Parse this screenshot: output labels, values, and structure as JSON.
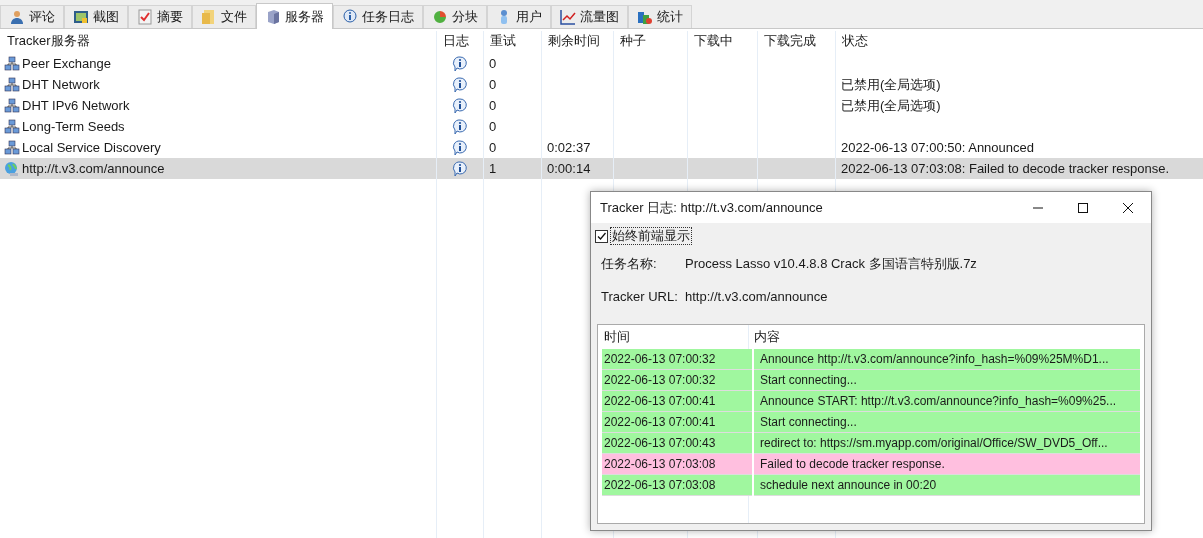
{
  "tabs": [
    {
      "label": "评论",
      "kind": "user",
      "selected": false
    },
    {
      "label": "截图",
      "kind": "image",
      "selected": false
    },
    {
      "label": "摘要",
      "kind": "check",
      "selected": false
    },
    {
      "label": "文件",
      "kind": "files",
      "selected": false
    },
    {
      "label": "服务器",
      "kind": "server",
      "selected": true
    },
    {
      "label": "任务日志",
      "kind": "info",
      "selected": false
    },
    {
      "label": "分块",
      "kind": "pie",
      "selected": false
    },
    {
      "label": "用户",
      "kind": "person",
      "selected": false
    },
    {
      "label": "流量图",
      "kind": "graph",
      "selected": false
    },
    {
      "label": "统计",
      "kind": "stats",
      "selected": false
    }
  ],
  "table": {
    "columns": [
      "Tracker服务器",
      "日志",
      "重试",
      "剩余时间",
      "种子",
      "下载中",
      "下载完成",
      "状态"
    ],
    "rows": [
      {
        "kind": "network",
        "name": "Peer Exchange",
        "retry": "0",
        "selected": false
      },
      {
        "kind": "network",
        "name": "DHT Network",
        "retry": "0",
        "status": "已禁用(全局选项)",
        "selected": false
      },
      {
        "kind": "network",
        "name": "DHT IPv6 Network",
        "retry": "0",
        "status": "已禁用(全局选项)",
        "selected": false
      },
      {
        "kind": "network",
        "name": "Long-Term Seeds",
        "retry": "0",
        "selected": false
      },
      {
        "kind": "network",
        "name": "Local Service Discovery",
        "retry": "0",
        "remaining": "0:02:37",
        "status": "2022-06-13 07:00:50: Announced",
        "selected": false
      },
      {
        "kind": "web",
        "name": "http://t.v3.com/announce",
        "retry": "1",
        "remaining": "0:00:14",
        "status": "2022-06-13 07:03:08: Failed to decode tracker response.",
        "selected": true
      }
    ]
  },
  "dialog": {
    "title": "Tracker 日志: http://t.v3.com/announce",
    "always_on_top": {
      "label": "始终前端显示",
      "checked": true
    },
    "task_name_label": "任务名称:",
    "task_name": "Process Lasso v10.4.8.8 Crack 多国语言特别版.7z",
    "url_label": "Tracker URL:",
    "url": "http://t.v3.com/announce",
    "log": {
      "columns": [
        "时间",
        "内容"
      ],
      "rows": [
        {
          "time": "2022-06-13 07:00:32",
          "content": "Announce http://t.v3.com/announce?info_hash=%09%25M%D1...",
          "kind": "ok"
        },
        {
          "time": "2022-06-13 07:00:32",
          "content": "Start connecting...",
          "kind": "ok"
        },
        {
          "time": "2022-06-13 07:00:41",
          "content": "Announce START: http://t.v3.com/announce?info_hash=%09%25...",
          "kind": "ok"
        },
        {
          "time": "2022-06-13 07:00:41",
          "content": "Start connecting...",
          "kind": "ok"
        },
        {
          "time": "2022-06-13 07:00:43",
          "content": "redirect to: https://sm.myapp.com/original/Office/SW_DVD5_Off...",
          "kind": "ok"
        },
        {
          "time": "2022-06-13 07:03:08",
          "content": "Failed to decode tracker response.",
          "kind": "error"
        },
        {
          "time": "2022-06-13 07:03:08",
          "content": "schedule next announce in 00:20",
          "kind": "ok"
        }
      ]
    }
  }
}
